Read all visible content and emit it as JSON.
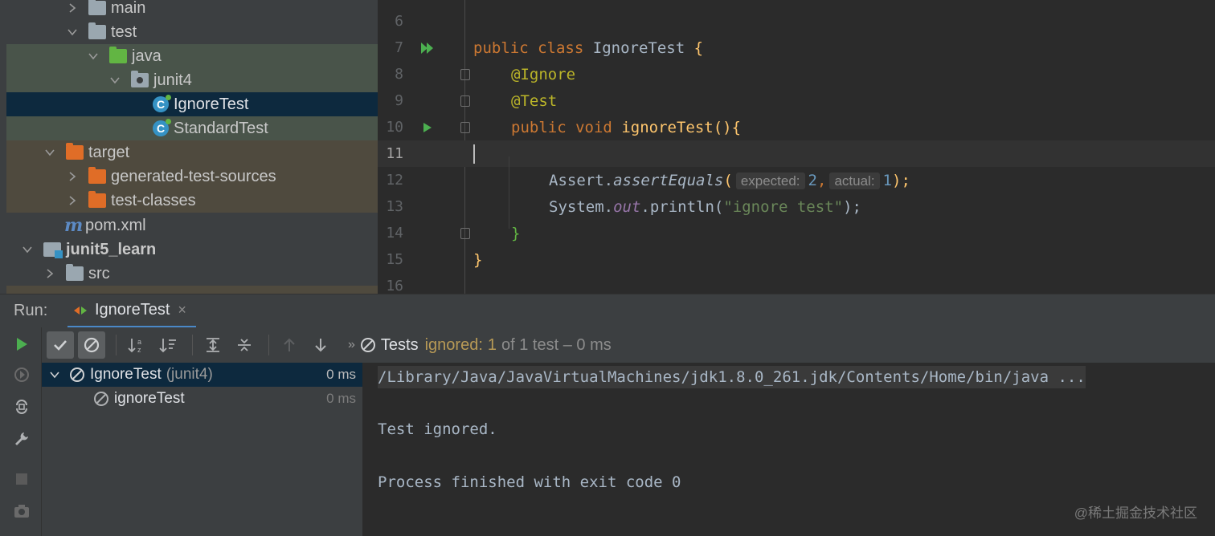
{
  "project_tree": {
    "rows": [
      {
        "label": "main"
      },
      {
        "label": "test"
      },
      {
        "label": "java"
      },
      {
        "label": "junit4"
      },
      {
        "label": "IgnoreTest"
      },
      {
        "label": "StandardTest"
      },
      {
        "label": "target"
      },
      {
        "label": "generated-test-sources"
      },
      {
        "label": "test-classes"
      },
      {
        "label": "pom.xml"
      },
      {
        "label": "junit5_learn"
      },
      {
        "label": "src"
      }
    ]
  },
  "editor": {
    "line_numbers": [
      "6",
      "7",
      "8",
      "9",
      "10",
      "11",
      "12",
      "13",
      "14",
      "15",
      "16"
    ],
    "code": {
      "public": "public",
      "class": "class",
      "class_name": "IgnoreTest",
      "brace_open": " {",
      "ann_ignore": "@Ignore",
      "ann_test": "@Test",
      "void": "void",
      "method": "ignoreTest",
      "method_parens": "(){",
      "assert_obj": "Assert.",
      "assert_method": "assertEquals",
      "paren_open": "(",
      "hint_expected": "expected:",
      "val_expected": "2",
      "comma": ",",
      "hint_actual": "actual:",
      "val_actual": "1",
      "paren_close": ");",
      "system": "System.",
      "out": "out",
      "println": ".println(",
      "string": "\"ignore test\"",
      "println_close": ");",
      "close_brace_inner": "}",
      "close_brace_outer": "}"
    }
  },
  "run_window": {
    "label": "Run:",
    "tab_title": "IgnoreTest",
    "tab_close": "×",
    "status": {
      "prefix": "Tests",
      "ignored_label": "ignored:",
      "ignored_count": "1",
      "rest": "of 1 test – 0 ms"
    },
    "test_tree": [
      {
        "name": "IgnoreTest",
        "package": "(junit4)",
        "time": "0 ms"
      },
      {
        "name": "ignoreTest",
        "time": "0 ms"
      }
    ],
    "console": {
      "command": "/Library/Java/JavaVirtualMachines/jdk1.8.0_261.jdk/Contents/Home/bin/java ...",
      "line1": "Test ignored.",
      "line2": "Process finished with exit code 0"
    }
  },
  "watermark": "@稀土掘金技术社区",
  "colors": {
    "tree_bg": "#3c3f41",
    "editor_bg": "#2b2b2b",
    "selection": "#0d293e",
    "keyword": "#cc7832",
    "annotation": "#bbb529",
    "function": "#ffc66d",
    "string": "#6a8759",
    "number": "#6897bb",
    "run_green": "#4caf50",
    "ignored": "#b89a56"
  }
}
